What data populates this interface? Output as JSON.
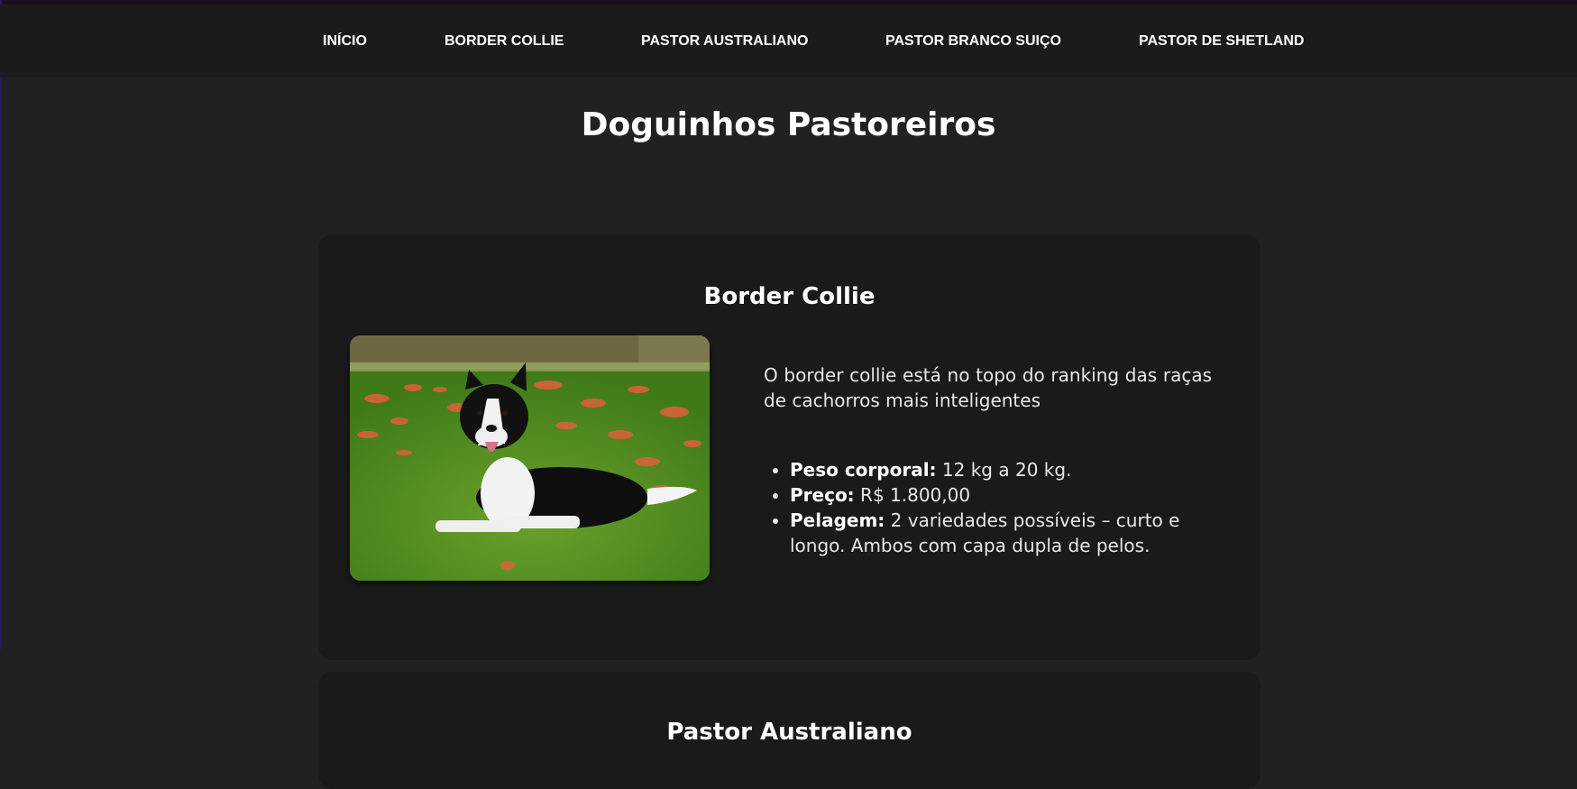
{
  "nav": {
    "items": [
      "INÍCIO",
      "BORDER COLLIE",
      "PASTOR AUSTRALIANO",
      "PASTOR BRANCO SUIÇO",
      "PASTOR DE SHETLAND"
    ]
  },
  "page_title": "Doguinhos Pastoreiros",
  "cards": [
    {
      "title": "Border Collie",
      "description": "O border collie está no topo do ranking das raças de cachorros mais inteligentes",
      "facts": [
        {
          "label": "Peso corporal:",
          "value": " 12 kg a 20 kg."
        },
        {
          "label": "Preço:",
          "value": " R$ 1.800,00"
        },
        {
          "label": "Pelagem:",
          "value": " 2 variedades possíveis – curto e longo. Ambos com capa dupla de pelos."
        }
      ]
    },
    {
      "title": "Pastor Australiano"
    }
  ],
  "colors": {
    "background": "#212121",
    "navbar": "#1b1b1b",
    "card": "#1a1a1a",
    "text": "#ffffff"
  }
}
